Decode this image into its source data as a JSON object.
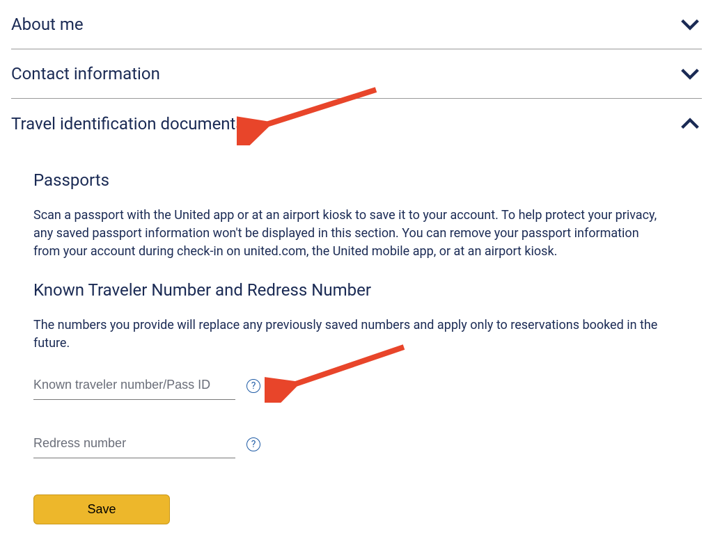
{
  "sections": {
    "about": {
      "title": "About me"
    },
    "contact": {
      "title": "Contact information"
    },
    "travel_docs": {
      "title": "Travel identification documents"
    }
  },
  "travel_docs": {
    "passports_heading": "Passports",
    "passports_body": "Scan a passport with the United app or at an airport kiosk to save it to your account. To help protect your privacy, any saved passport information won't be displayed in this section. You can remove your passport information from your account during check-in on united.com, the United mobile app, or at an airport kiosk.",
    "ktn_heading": "Known Traveler Number and Redress Number",
    "ktn_body": "The numbers you provide will replace any previously saved numbers and apply only to reservations booked in the future.",
    "ktn_placeholder": "Known traveler number/Pass ID",
    "redress_placeholder": "Redress number",
    "ktn_value": "",
    "redress_value": "",
    "help_symbol": "?",
    "save_label": "Save"
  }
}
